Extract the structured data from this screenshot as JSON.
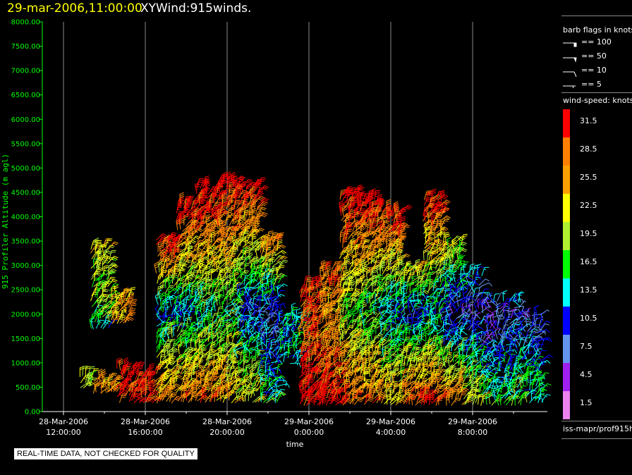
{
  "header": {
    "date": "29-mar-2006,11:00:00",
    "name": "XYWind:915winds."
  },
  "banner": "REAL-TIME DATA, NOT CHECKED FOR QUALITY",
  "legend": {
    "flags_title": "barb flags in knots",
    "flags": [
      "== 100",
      "== 50",
      "== 10",
      "== 5"
    ],
    "speed_title": "wind-speed: knots",
    "source": "iss-mapr/prof915h"
  },
  "chart_data": {
    "type": "wind-barb",
    "xlabel": "time",
    "ylabel": "915 Profiler Altitude (m agl)",
    "ylim": [
      0,
      8000
    ],
    "yticks": [
      "0.00",
      "500.00",
      "1000.00",
      "1500.00",
      "2000.00",
      "2500.00",
      "3000.00",
      "3500.00",
      "4000.00",
      "4500.00",
      "5000.00",
      "5500.00",
      "6000.00",
      "6500.00",
      "7000.00",
      "7500.00",
      "8000.00"
    ],
    "xlim": [
      "28-Mar-2006 11:00",
      "29-Mar-2006 11:40"
    ],
    "xticks": [
      {
        "date": "28-Mar-2006",
        "time": "12:00:00"
      },
      {
        "date": "28-Mar-2006",
        "time": "16:00:00"
      },
      {
        "date": "28-Mar-2006",
        "time": "20:00:00"
      },
      {
        "date": "29-Mar-2006",
        "time": "0:00:00"
      },
      {
        "date": "29-Mar-2006",
        "time": "4:00:00"
      },
      {
        "date": "29-Mar-2006",
        "time": "8:00:00"
      }
    ],
    "colorbar": [
      {
        "label": "31.5",
        "color": "#ff0000"
      },
      {
        "label": "28.5",
        "color": "#ff8000"
      },
      {
        "label": "25.5",
        "color": "#ffa000"
      },
      {
        "label": "22.5",
        "color": "#ffff00"
      },
      {
        "label": "19.5",
        "color": "#b0f030"
      },
      {
        "label": "16.5",
        "color": "#00ff00"
      },
      {
        "label": "13.5",
        "color": "#00ffff"
      },
      {
        "label": "10.5",
        "color": "#0000ff"
      },
      {
        "label": "7.5",
        "color": "#6495ed"
      },
      {
        "label": "4.5",
        "color": "#a020f0"
      },
      {
        "label": "1.5",
        "color": "#ee82ee"
      }
    ],
    "profiles_columns": [
      "time",
      "bottom_m",
      "top_m",
      "speed_low_kt",
      "speed_2000m_kt",
      "speed_top_kt"
    ],
    "profiles": [
      [
        "28-Mar-2006 13:00",
        500,
        750,
        20,
        20,
        20
      ],
      [
        "28-Mar-2006 13:45",
        1700,
        3400,
        14,
        18,
        22
      ],
      [
        "28-Mar-2006 14:00",
        400,
        650,
        26,
        26,
        26
      ],
      [
        "28-Mar-2006 14:45",
        1800,
        2400,
        26,
        26,
        26
      ],
      [
        "28-Mar-2006 15:00",
        200,
        900,
        32,
        32,
        32
      ],
      [
        "28-Mar-2006 16:00",
        200,
        800,
        32,
        31,
        31
      ],
      [
        "28-Mar-2006 17:00",
        200,
        3500,
        28,
        12,
        32
      ],
      [
        "28-Mar-2006 18:00",
        200,
        4300,
        27,
        13,
        33
      ],
      [
        "28-Mar-2006 19:00",
        200,
        4600,
        28,
        15,
        34
      ],
      [
        "28-Mar-2006 20:00",
        200,
        4800,
        26,
        16,
        34
      ],
      [
        "28-Mar-2006 21:00",
        200,
        4600,
        22,
        10,
        33
      ],
      [
        "28-Mar-2006 22:00",
        200,
        3500,
        16,
        8,
        28
      ],
      [
        "28-Mar-2006 23:00",
        1000,
        2000,
        14,
        14,
        14
      ],
      [
        "29-Mar-2006 00:00",
        150,
        2600,
        32,
        28,
        30
      ],
      [
        "29-Mar-2006 01:00",
        150,
        3000,
        32,
        25,
        30
      ],
      [
        "29-Mar-2006 02:00",
        150,
        4500,
        30,
        18,
        34
      ],
      [
        "29-Mar-2006 03:00",
        150,
        4400,
        28,
        16,
        33
      ],
      [
        "29-Mar-2006 04:00",
        150,
        4200,
        25,
        12,
        33
      ],
      [
        "29-Mar-2006 05:00",
        150,
        3000,
        30,
        10,
        25
      ],
      [
        "29-Mar-2006 06:00",
        150,
        4400,
        30,
        12,
        33
      ],
      [
        "29-Mar-2006 07:00",
        150,
        3500,
        28,
        8,
        22
      ],
      [
        "29-Mar-2006 08:00",
        150,
        2800,
        22,
        7,
        12
      ],
      [
        "29-Mar-2006 09:00",
        150,
        2300,
        16,
        6,
        10
      ],
      [
        "29-Mar-2006 10:00",
        150,
        2300,
        18,
        8,
        12
      ],
      [
        "29-Mar-2006 11:00",
        200,
        2000,
        16,
        8,
        12
      ]
    ]
  }
}
